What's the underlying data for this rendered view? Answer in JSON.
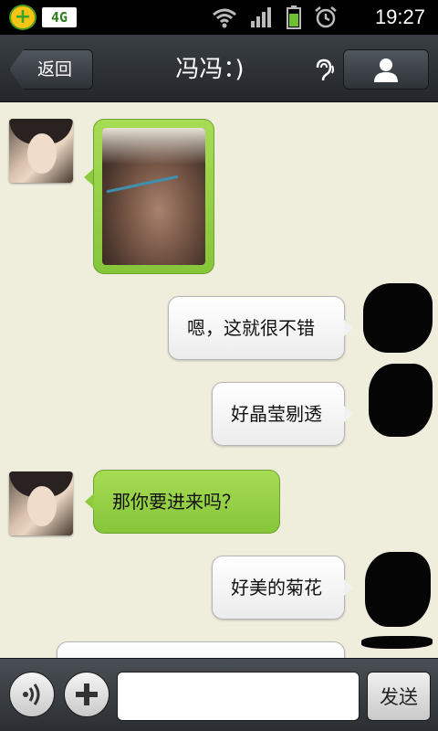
{
  "status_bar": {
    "network_badge": "4G",
    "time": "19:27",
    "icons": [
      "app-icon",
      "wifi-icon",
      "signal-icon",
      "battery-icon",
      "alarm-icon"
    ]
  },
  "header": {
    "back_label": "返回",
    "title": "冯冯：)"
  },
  "messages": [
    {
      "side": "in",
      "type": "image"
    },
    {
      "side": "out",
      "type": "text",
      "text": "嗯，这就很不错"
    },
    {
      "side": "out",
      "type": "text",
      "text": "好晶莹剔透"
    },
    {
      "side": "in",
      "type": "text",
      "text": "那你要进来吗？"
    },
    {
      "side": "out",
      "type": "text",
      "text": "好美的菊花"
    }
  ],
  "input": {
    "value": "",
    "placeholder": "",
    "send_label": "发送"
  },
  "colors": {
    "incoming_bubble": "#8ccb3e",
    "outgoing_bubble": "#f4f4f4",
    "chat_background": "#efeedd",
    "header_background": "#2e3338"
  }
}
